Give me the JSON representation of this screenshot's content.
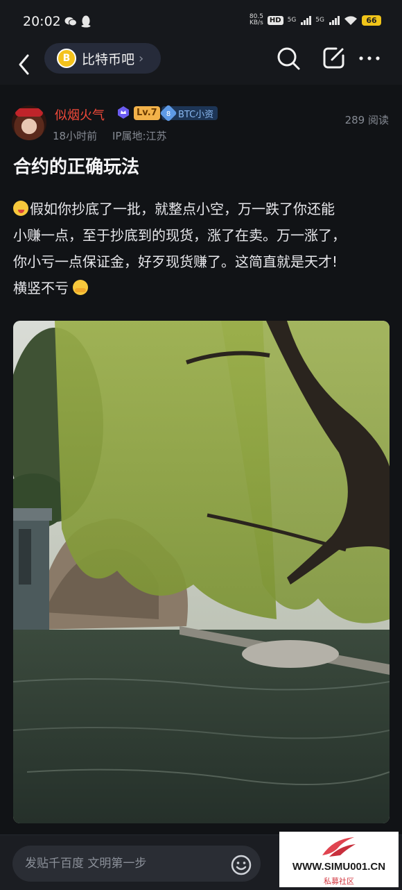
{
  "status_bar": {
    "time": "20:02",
    "net_speed_value": "80.5",
    "net_speed_unit": "KB/s",
    "hd": "HD",
    "sim1": "5G",
    "sim2": "5G",
    "battery": "66"
  },
  "nav": {
    "forum_name": "比特币吧",
    "forum_icon_letter": "B",
    "chevron": "›"
  },
  "post": {
    "author": "似烟火气",
    "level": "Lv.7",
    "badge_number": "8",
    "badge_text": "BTC小资",
    "time_ago": "18小时前",
    "ip_location": "IP属地:江苏",
    "views": "289 阅读",
    "title": "合约的正确玩法",
    "body_line1": "假如你抄底了一批，就整点小空，万一跌了你还能",
    "body_line2": "小赚一点，至于抄底到的现货，涨了在卖。万一涨了，",
    "body_line3": "你小亏一点保证金，好歹现货赚了。这简直就是天才!",
    "body_line4": "横竖不亏"
  },
  "bottom": {
    "reply_placeholder": "发贴千百度 文明第一步"
  },
  "watermark": {
    "url": "WWW.SIMU001.CN",
    "subtitle": "私募社区"
  },
  "colors": {
    "background": "#16181c",
    "username": "#f34a3a",
    "level_badge": "#f2b24a",
    "battery": "#f0c419"
  }
}
